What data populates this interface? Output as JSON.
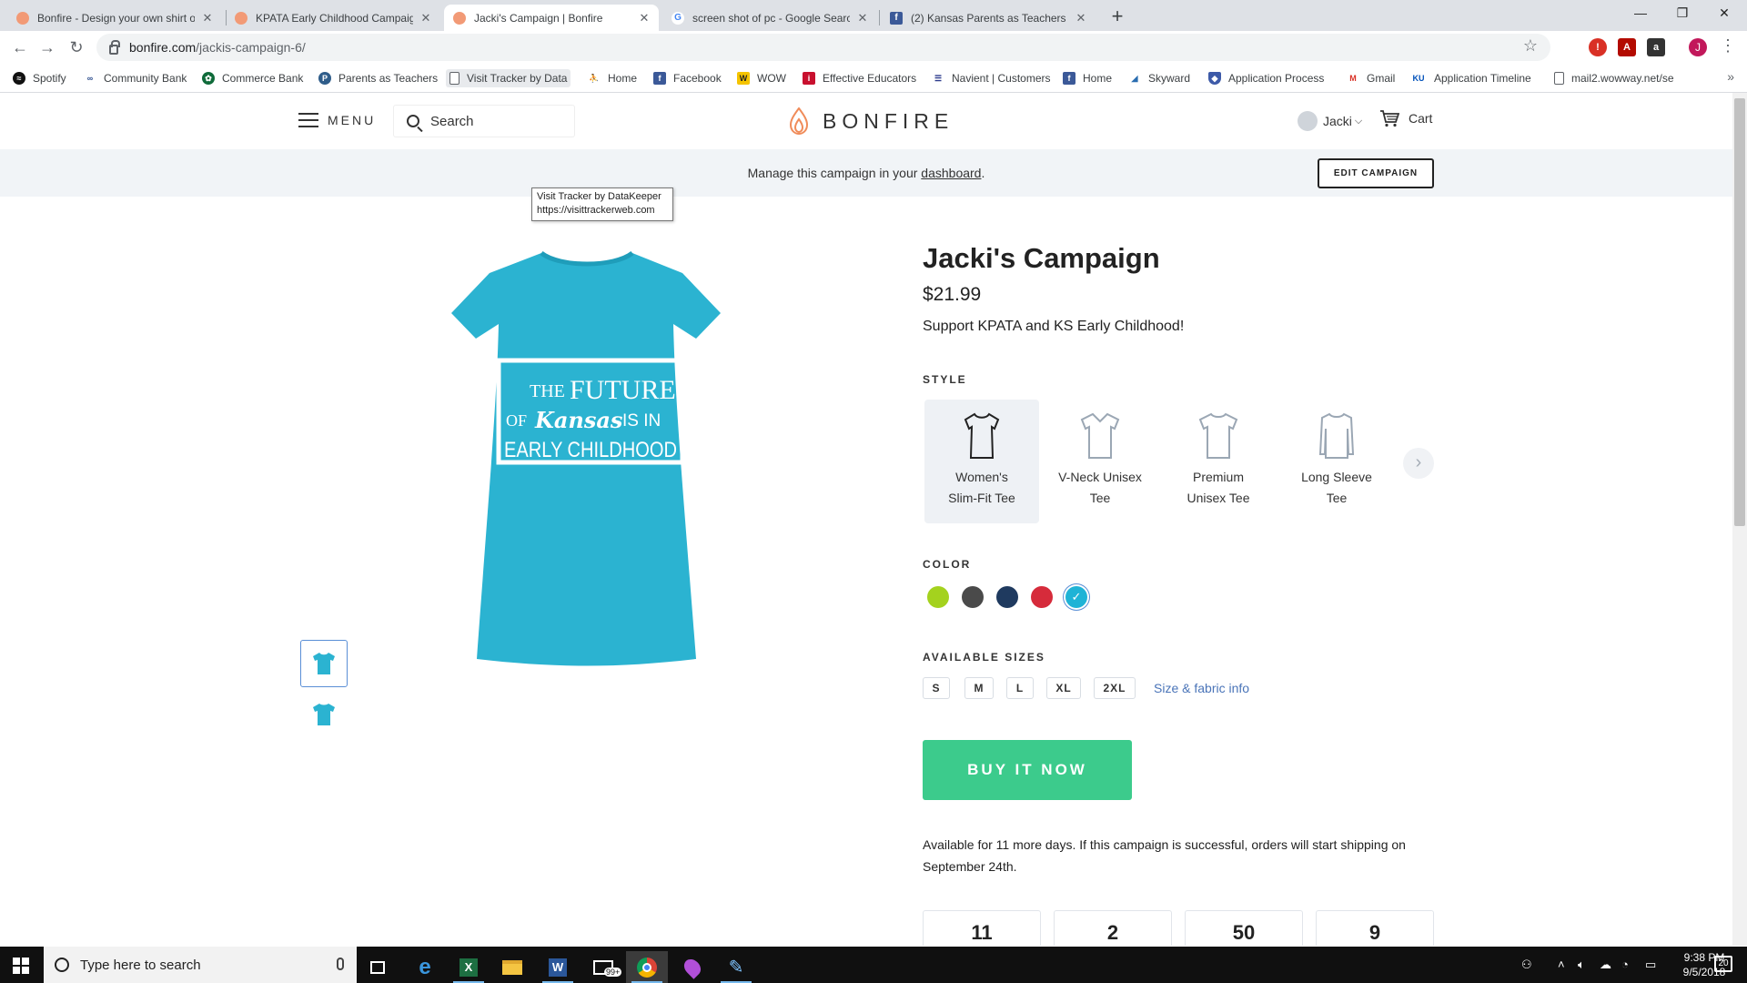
{
  "browser": {
    "tabs": [
      {
        "title": "Bonfire - Design your own shirt o",
        "favicon": "bonfire-icon"
      },
      {
        "title": "KPATA Early Childhood Campaign",
        "favicon": "bonfire-icon"
      },
      {
        "title": "Jacki's Campaign | Bonfire",
        "favicon": "bonfire-icon",
        "active": true
      },
      {
        "title": "screen shot of pc - Google Searc",
        "favicon": "google-icon"
      },
      {
        "title": "(2) Kansas Parents as Teachers As",
        "favicon": "facebook-icon"
      }
    ],
    "url_host": "bonfire.com",
    "url_path": "/jackis-campaign-6/",
    "profile_initial": "J",
    "bookmarks": [
      "Spotify",
      "Community Bank",
      "Commerce Bank",
      "Parents as Teachers",
      "Visit Tracker by Data",
      "Home",
      "Facebook",
      "WOW",
      "Effective Educators",
      "Navient | Customers",
      "Home",
      "Skyward",
      "Application Process",
      "Gmail",
      "Application Timeline",
      "mail2.wowway.net/se"
    ],
    "tooltip": {
      "line1": "Visit Tracker by DataKeeper",
      "line2": "https://visittrackerweb.com"
    }
  },
  "site": {
    "menu_label": "MENU",
    "search_placeholder": "Search",
    "logo_text": "BONFIRE",
    "user_name": "Jacki",
    "cart_label": "Cart",
    "manage_prefix": "Manage this campaign in your",
    "manage_link": "dashboard",
    "manage_suffix": ".",
    "edit_button": "EDIT CAMPAIGN"
  },
  "product": {
    "title": "Jacki's Campaign",
    "price": "$21.99",
    "tagline": "Support KPATA and KS Early Childhood!",
    "shirt_color": "#2bb3d1",
    "shirt_text": {
      "l1a": "THE",
      "l1b": "FUTURE",
      "l2a": "OF",
      "l2b": "Kansas",
      "l2c": "IS IN",
      "l3": "EARLY CHILDHOOD"
    },
    "style_label": "STYLE",
    "styles": [
      {
        "line1": "Women's",
        "line2": "Slim-Fit Tee"
      },
      {
        "line1": "V-Neck Unisex",
        "line2": "Tee"
      },
      {
        "line1": "Premium",
        "line2": "Unisex Tee"
      },
      {
        "line1": "Long Sleeve",
        "line2": "Tee"
      }
    ],
    "color_label": "COLOR",
    "colors": [
      "#a4d21e",
      "#4a4a4a",
      "#1f3a5f",
      "#d62b3b",
      "#1fb3d6"
    ],
    "sizes_label": "AVAILABLE SIZES",
    "sizes": [
      "S",
      "M",
      "L",
      "XL",
      "2XL"
    ],
    "size_info_link": "Size & fabric info",
    "buy_button": "BUY IT NOW",
    "availability": "Available for 11 more days. If this campaign is successful, orders will start shipping on September 24th.",
    "countdown": [
      "11",
      "2",
      "50",
      "9"
    ]
  },
  "taskbar": {
    "search_placeholder": "Type here to search",
    "time": "9:38 PM",
    "date": "9/5/2018",
    "mail_badge": "99+",
    "notification_count": "20"
  }
}
